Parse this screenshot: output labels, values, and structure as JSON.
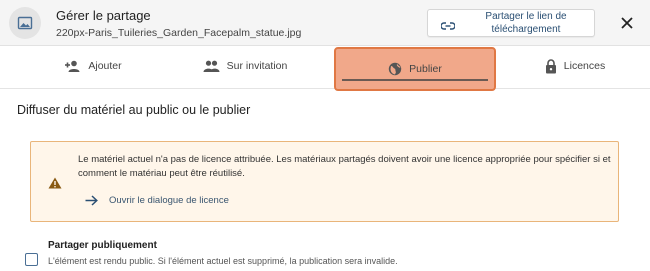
{
  "header": {
    "title": "Gérer le partage",
    "filename": "220px-Paris_Tuileries_Garden_Facepalm_statue.jpg",
    "share_link_label": "Partager le lien de téléchargement",
    "file_icon": "image-icon",
    "close_icon": "close-icon"
  },
  "tabs": [
    {
      "label": "Ajouter",
      "icon": "add-person-icon"
    },
    {
      "label": "Sur invitation",
      "icon": "people-icon"
    },
    {
      "label": "Publier",
      "icon": "globe-icon"
    },
    {
      "label": "Licences",
      "icon": "lock-icon"
    }
  ],
  "main": {
    "section_title": "Diffuser du matériel au public ou le publier",
    "warning": {
      "text": "Le matériel actuel n'a pas de licence attribuée. Les matériaux partagés doivent avoir une licence appropriée pour spécifier si et comment le matériau peut être réutilisé.",
      "link_label": "Ouvrir le dialogue de licence"
    },
    "public_share": {
      "label": "Partager publiquement",
      "description": "L'élément est rendu public. Si l'élément actuel est supprimé, la publication sera invalide."
    }
  },
  "colors": {
    "accent": "#2a4f73",
    "highlight_fill": "#f1a88a",
    "highlight_border": "#e07844",
    "warning_bg": "#fff6ea",
    "warning_border": "#e9b57a",
    "warning_icon": "#8a5a12"
  }
}
